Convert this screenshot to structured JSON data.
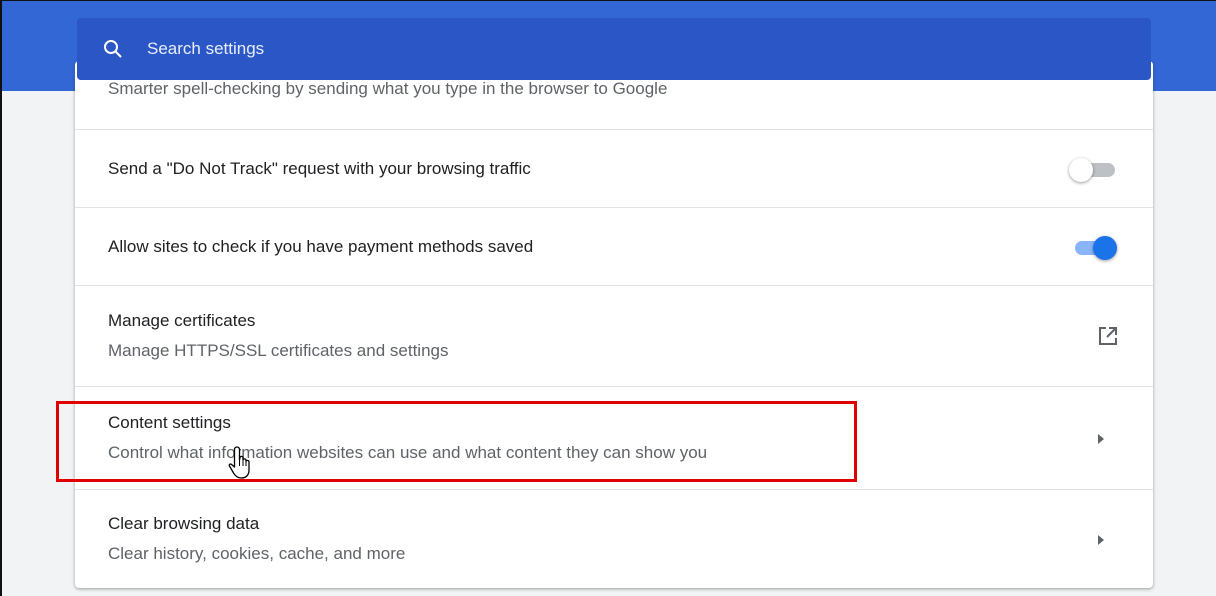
{
  "search": {
    "placeholder": "Search settings",
    "icon": "search-icon"
  },
  "partial_row": {
    "text": "Smarter spell-checking by sending what you type in the browser to Google"
  },
  "rows": [
    {
      "primary": "Send a \"Do Not Track\" request with your browsing traffic",
      "control": "toggle",
      "state": "off"
    },
    {
      "primary": "Allow sites to check if you have payment methods saved",
      "control": "toggle",
      "state": "on"
    },
    {
      "primary": "Manage certificates",
      "secondary": "Manage HTTPS/SSL certificates and settings",
      "control": "open-in-new-icon"
    },
    {
      "primary": "Content settings",
      "secondary": "Control what information websites can use and what content they can show you",
      "control": "arrow-right-icon"
    },
    {
      "primary": "Clear browsing data",
      "secondary": "Clear history, cookies, cache, and more",
      "control": "arrow-right-icon"
    }
  ],
  "colors": {
    "header_blue": "#3367d6",
    "search_blue": "#2a56c6",
    "toggle_on": "#1a73e8",
    "highlight": "#e00000"
  }
}
